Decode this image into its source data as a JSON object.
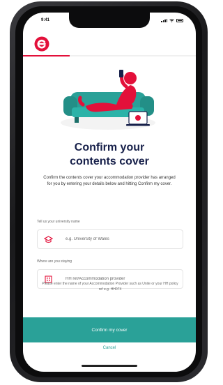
{
  "status_bar": {
    "time": "9:41"
  },
  "header": {
    "progress_fraction": 0.27
  },
  "brand": {
    "accent": "#e3103a",
    "teal": "#2aa198",
    "navy": "#17204a"
  },
  "icons": {
    "logo": "brand-logo-icon",
    "university": "university-icon",
    "building": "building-icon"
  },
  "page": {
    "title_line1": "Confirm your",
    "title_line2": "contents cover",
    "description": "Confirm the contents cover your accommodation provider has arranged for you by entering your details below and hitting Confirm my cover."
  },
  "form": {
    "university": {
      "label": "Tell us your university name",
      "placeholder": "e.g. University of Wales",
      "value": ""
    },
    "accommodation": {
      "label": "Where are you staying",
      "placeholder": "HH ref/Accommodation provider",
      "value": ""
    }
  },
  "hint": "Please enter the name of your Accommodation Provider such as Unite or your HH policy ref e.g. HH074",
  "actions": {
    "confirm_label": "Confirm my cover",
    "cancel_label": "Cancel"
  }
}
